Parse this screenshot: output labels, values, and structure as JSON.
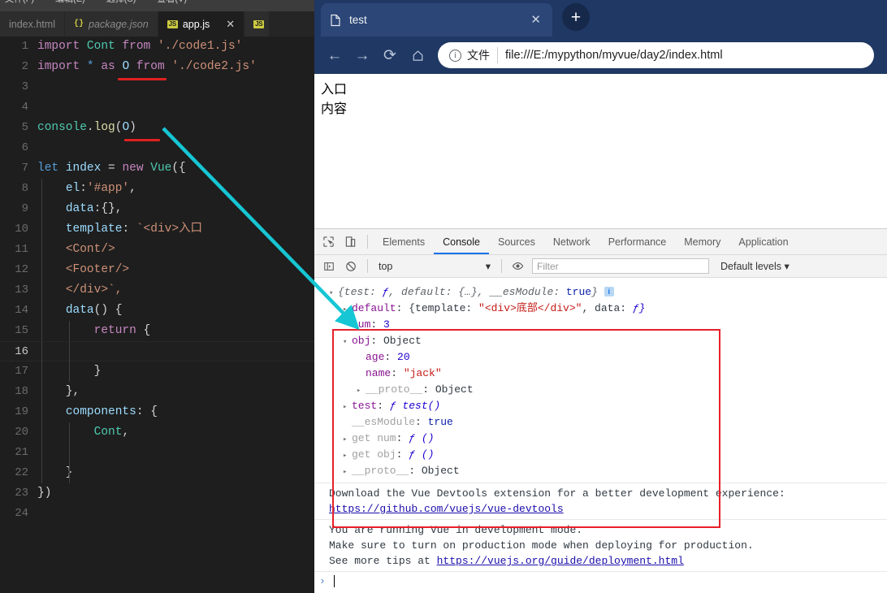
{
  "editor": {
    "menubar": [
      "文件(F)",
      "编辑(E)",
      "选择(S)",
      "查看(V)"
    ],
    "tabs": [
      {
        "label": "index.html",
        "icon": "html-icon",
        "state": "inactive"
      },
      {
        "label": "package.json",
        "icon": "json-icon",
        "state": "preview"
      },
      {
        "label": "app.js",
        "icon": "js-icon",
        "state": "active",
        "close": "✕"
      },
      {
        "label": "",
        "icon": "js-icon",
        "state": "partial"
      }
    ],
    "lines": [
      {
        "n": "1",
        "text": "import Cont from './code1.js'"
      },
      {
        "n": "2",
        "text": "import * as O from './code2.js'"
      },
      {
        "n": "3",
        "text": ""
      },
      {
        "n": "4",
        "text": ""
      },
      {
        "n": "5",
        "text": "console.log(O)"
      },
      {
        "n": "6",
        "text": ""
      },
      {
        "n": "7",
        "text": "let index = new Vue({"
      },
      {
        "n": "8",
        "text": "    el:'#app',"
      },
      {
        "n": "9",
        "text": "    data:{},"
      },
      {
        "n": "10",
        "text": "    template: `<div>入口"
      },
      {
        "n": "11",
        "text": "    <Cont/>"
      },
      {
        "n": "12",
        "text": "    <Footer/>"
      },
      {
        "n": "13",
        "text": "    </div>`,"
      },
      {
        "n": "14",
        "text": "    data() {"
      },
      {
        "n": "15",
        "text": "        return {"
      },
      {
        "n": "16",
        "text": ""
      },
      {
        "n": "17",
        "text": "        }"
      },
      {
        "n": "18",
        "text": "    },"
      },
      {
        "n": "19",
        "text": "    components: {"
      },
      {
        "n": "20",
        "text": "        Cont,"
      },
      {
        "n": "21",
        "text": ""
      },
      {
        "n": "22",
        "text": "    }"
      },
      {
        "n": "23",
        "text": "})"
      },
      {
        "n": "24",
        "text": ""
      }
    ]
  },
  "browser": {
    "tab": {
      "title": "test",
      "close_label": "✕"
    },
    "newtab_label": "+",
    "nav": {
      "back": "←",
      "forward": "→",
      "reload": "⟳",
      "home": "⌂"
    },
    "omnibox": {
      "info_glyph": "i",
      "scheme_label": "文件",
      "url": "file:///E:/mypython/myvue/day2/index.html"
    },
    "page": {
      "lines": [
        "入口",
        "内容"
      ]
    }
  },
  "devtools": {
    "tabs": [
      "Elements",
      "Console",
      "Sources",
      "Network",
      "Performance",
      "Memory",
      "Application"
    ],
    "active_tab": "Console",
    "context": {
      "value": "top",
      "chevron": "▾"
    },
    "filter_placeholder": "Filter",
    "levels": {
      "label": "Default levels",
      "chevron": "▾"
    },
    "console": {
      "object_rows": [
        {
          "indent": 0,
          "toggle": "▾",
          "segments": [
            {
              "text": "{test: ",
              "cls": "o-key-italic"
            },
            {
              "text": "ƒ",
              "cls": "o-fn"
            },
            {
              "text": ", default: {…}, __esModule: ",
              "cls": "o-key-italic"
            },
            {
              "text": "true",
              "cls": "o-bool"
            },
            {
              "text": "}",
              "cls": "o-key-italic"
            },
            {
              "text": " ",
              "cls": "o-obj"
            },
            {
              "text": "i",
              "cls": "info-badge"
            }
          ]
        },
        {
          "indent": 1,
          "toggle": "▸",
          "segments": [
            {
              "text": "default",
              "cls": "o-prop"
            },
            {
              "text": ": {template: ",
              "cls": "o-obj"
            },
            {
              "text": "\"<div>底部</div>\"",
              "cls": "o-str"
            },
            {
              "text": ", data: ",
              "cls": "o-obj"
            },
            {
              "text": "ƒ}",
              "cls": "o-fn"
            }
          ]
        },
        {
          "indent": 1,
          "toggle": " ",
          "segments": [
            {
              "text": "num",
              "cls": "o-prop"
            },
            {
              "text": ": ",
              "cls": "o-obj"
            },
            {
              "text": "3",
              "cls": "o-num"
            }
          ]
        },
        {
          "indent": 1,
          "toggle": "▾",
          "segments": [
            {
              "text": "obj",
              "cls": "o-prop"
            },
            {
              "text": ": Object",
              "cls": "o-obj"
            }
          ]
        },
        {
          "indent": 2,
          "toggle": " ",
          "segments": [
            {
              "text": "age",
              "cls": "o-prop"
            },
            {
              "text": ": ",
              "cls": "o-obj"
            },
            {
              "text": "20",
              "cls": "o-num"
            }
          ]
        },
        {
          "indent": 2,
          "toggle": " ",
          "segments": [
            {
              "text": "name",
              "cls": "o-prop"
            },
            {
              "text": ": ",
              "cls": "o-obj"
            },
            {
              "text": "\"jack\"",
              "cls": "o-str"
            }
          ]
        },
        {
          "indent": 2,
          "toggle": "▸",
          "segments": [
            {
              "text": "__proto__",
              "cls": "o-prop-grey"
            },
            {
              "text": ": Object",
              "cls": "o-obj"
            }
          ]
        },
        {
          "indent": 1,
          "toggle": "▸",
          "segments": [
            {
              "text": "test",
              "cls": "o-prop"
            },
            {
              "text": ": ",
              "cls": "o-obj"
            },
            {
              "text": "ƒ test()",
              "cls": "o-fn"
            }
          ]
        },
        {
          "indent": 1,
          "toggle": " ",
          "segments": [
            {
              "text": "__esModule",
              "cls": "o-prop-grey"
            },
            {
              "text": ": ",
              "cls": "o-obj"
            },
            {
              "text": "true",
              "cls": "o-bool"
            }
          ]
        },
        {
          "indent": 1,
          "toggle": "▸",
          "segments": [
            {
              "text": "get num",
              "cls": "o-prop-grey"
            },
            {
              "text": ": ",
              "cls": "o-obj"
            },
            {
              "text": "ƒ ()",
              "cls": "o-fn"
            }
          ]
        },
        {
          "indent": 1,
          "toggle": "▸",
          "segments": [
            {
              "text": "get obj",
              "cls": "o-prop-grey"
            },
            {
              "text": ": ",
              "cls": "o-obj"
            },
            {
              "text": "ƒ ()",
              "cls": "o-fn"
            }
          ]
        },
        {
          "indent": 1,
          "toggle": "▸",
          "segments": [
            {
              "text": "__proto__",
              "cls": "o-prop-grey"
            },
            {
              "text": ": Object",
              "cls": "o-obj"
            }
          ]
        }
      ],
      "messages": [
        {
          "lines": [
            [
              {
                "text": "Download the Vue Devtools extension for a better development experience:",
                "cls": ""
              }
            ],
            [
              {
                "text": "https://github.com/vuejs/vue-devtools",
                "cls": "msg-link"
              }
            ]
          ]
        },
        {
          "lines": [
            [
              {
                "text": "You are running Vue in development mode.",
                "cls": ""
              }
            ],
            [
              {
                "text": "Make sure to turn on production mode when deploying for production.",
                "cls": ""
              }
            ],
            [
              {
                "text": "See more tips at ",
                "cls": ""
              },
              {
                "text": "https://vuejs.org/guide/deployment.html",
                "cls": "msg-link"
              }
            ]
          ]
        }
      ],
      "prompt_caret": "›"
    }
  },
  "annotations": {
    "arrow_color": "#16c6d4",
    "box_color": "#e8202a",
    "underline_color": "#e02020"
  }
}
